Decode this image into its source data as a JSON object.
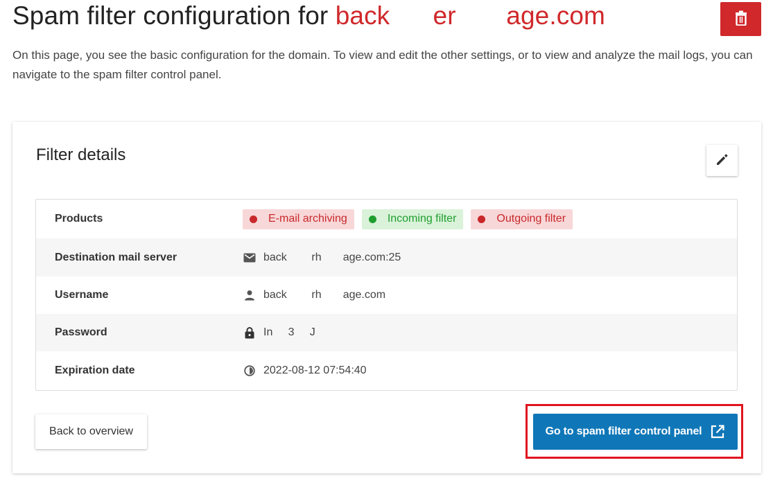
{
  "header": {
    "title_prefix": "Spam filter configuration for ",
    "title_domain": "back      er       age.com",
    "delete_icon": "trash-icon",
    "delete_color": "#d0282b"
  },
  "intro": "On this page, you see the basic configuration for the domain. To view and edit the other settings, or to view and analyze the mail logs, you can navigate to the spam filter control panel.",
  "card": {
    "title": "Filter details",
    "edit_icon": "pencil-icon",
    "rows": {
      "products": {
        "label": "Products",
        "badges": [
          {
            "label": "E-mail archiving",
            "status": "red",
            "color": "#c8282b"
          },
          {
            "label": "Incoming filter",
            "status": "green",
            "color": "#1f9e2e"
          },
          {
            "label": "Outgoing filter",
            "status": "red",
            "color": "#c8282b"
          }
        ]
      },
      "destination": {
        "label": "Destination mail server",
        "icon": "mail-icon",
        "value": "back        rh       age.com:25"
      },
      "username": {
        "label": "Username",
        "icon": "person-icon",
        "value": "back        rh       age.com"
      },
      "password": {
        "label": "Password",
        "icon": "lock-icon",
        "value": "In     3     J"
      },
      "expiration": {
        "label": "Expiration date",
        "icon": "clock-icon",
        "value": "2022-08-12 07:54:40"
      }
    }
  },
  "actions": {
    "back_label": "Back to overview",
    "control_panel_label": "Go to spam filter control panel",
    "control_panel_icon": "external-link-icon",
    "control_panel_color": "#0f77b8"
  }
}
